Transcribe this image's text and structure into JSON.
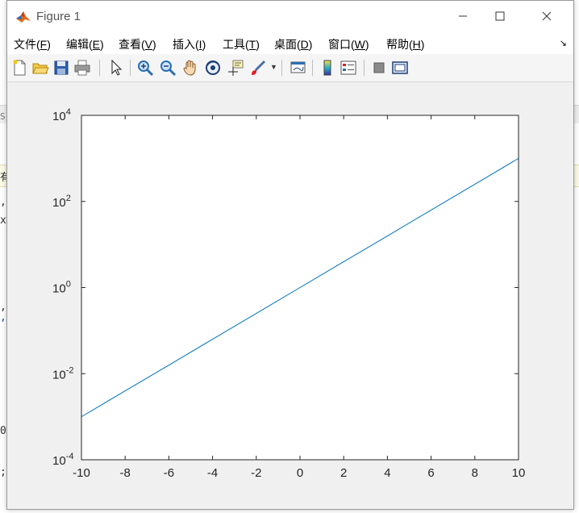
{
  "window": {
    "title": "Figure 1"
  },
  "menu": [
    {
      "id": "file",
      "label": "文件(F)",
      "underline": "F"
    },
    {
      "id": "edit",
      "label": "编辑(E)",
      "underline": "E"
    },
    {
      "id": "view",
      "label": "查看(V)",
      "underline": "V"
    },
    {
      "id": "insert",
      "label": "插入(I)",
      "underline": "I"
    },
    {
      "id": "tools",
      "label": "工具(T)",
      "underline": "T"
    },
    {
      "id": "desktop",
      "label": "桌面(D)",
      "underline": "D"
    },
    {
      "id": "window",
      "label": "窗口(W)",
      "underline": "W"
    },
    {
      "id": "help",
      "label": "帮助(H)",
      "underline": "H"
    }
  ],
  "toolbar_icons": [
    "new-figure-icon",
    "open-file-icon",
    "save-icon",
    "print-icon",
    "pointer-icon",
    "zoom-in-icon",
    "zoom-out-icon",
    "pan-hand-icon",
    "rotate-3d-icon",
    "data-cursor-icon",
    "brush-icon",
    "brush-dropdown-icon",
    "link-plot-icon",
    "colorbar-icon",
    "legend-icon",
    "hide-plot-tools-icon",
    "show-plot-tools-icon"
  ],
  "colors": {
    "line": "#0072bd",
    "axes_bg": "#ffffff",
    "figure_bg": "#f0f0f0"
  },
  "chart_data": {
    "type": "line",
    "title": "",
    "xlabel": "",
    "ylabel": "",
    "xlim": [
      -10,
      10
    ],
    "ylim": [
      0.0001,
      10000
    ],
    "yscale": "log",
    "xticks": [
      -10,
      -8,
      -6,
      -4,
      -2,
      0,
      2,
      4,
      6,
      8,
      10
    ],
    "yticks": [
      {
        "value": 0.0001,
        "base": "10",
        "exp": "-4"
      },
      {
        "value": 0.01,
        "base": "10",
        "exp": "-2"
      },
      {
        "value": 1,
        "base": "10",
        "exp": "0"
      },
      {
        "value": 100,
        "base": "10",
        "exp": "2"
      },
      {
        "value": 10000,
        "base": "10",
        "exp": "4"
      }
    ],
    "grid": false,
    "series": [
      {
        "x": [
          -10,
          -8,
          -6,
          -4,
          -2,
          0,
          2,
          4,
          6,
          8,
          10
        ],
        "y": [
          0.001,
          0.00398,
          0.0158,
          0.0631,
          0.251,
          1,
          3.98,
          15.8,
          63.1,
          251,
          1000
        ]
      }
    ]
  },
  "background_glyphs": [
    ",",
    "x",
    ",",
    ",",
    "0.",
    ";",
    "有"
  ]
}
